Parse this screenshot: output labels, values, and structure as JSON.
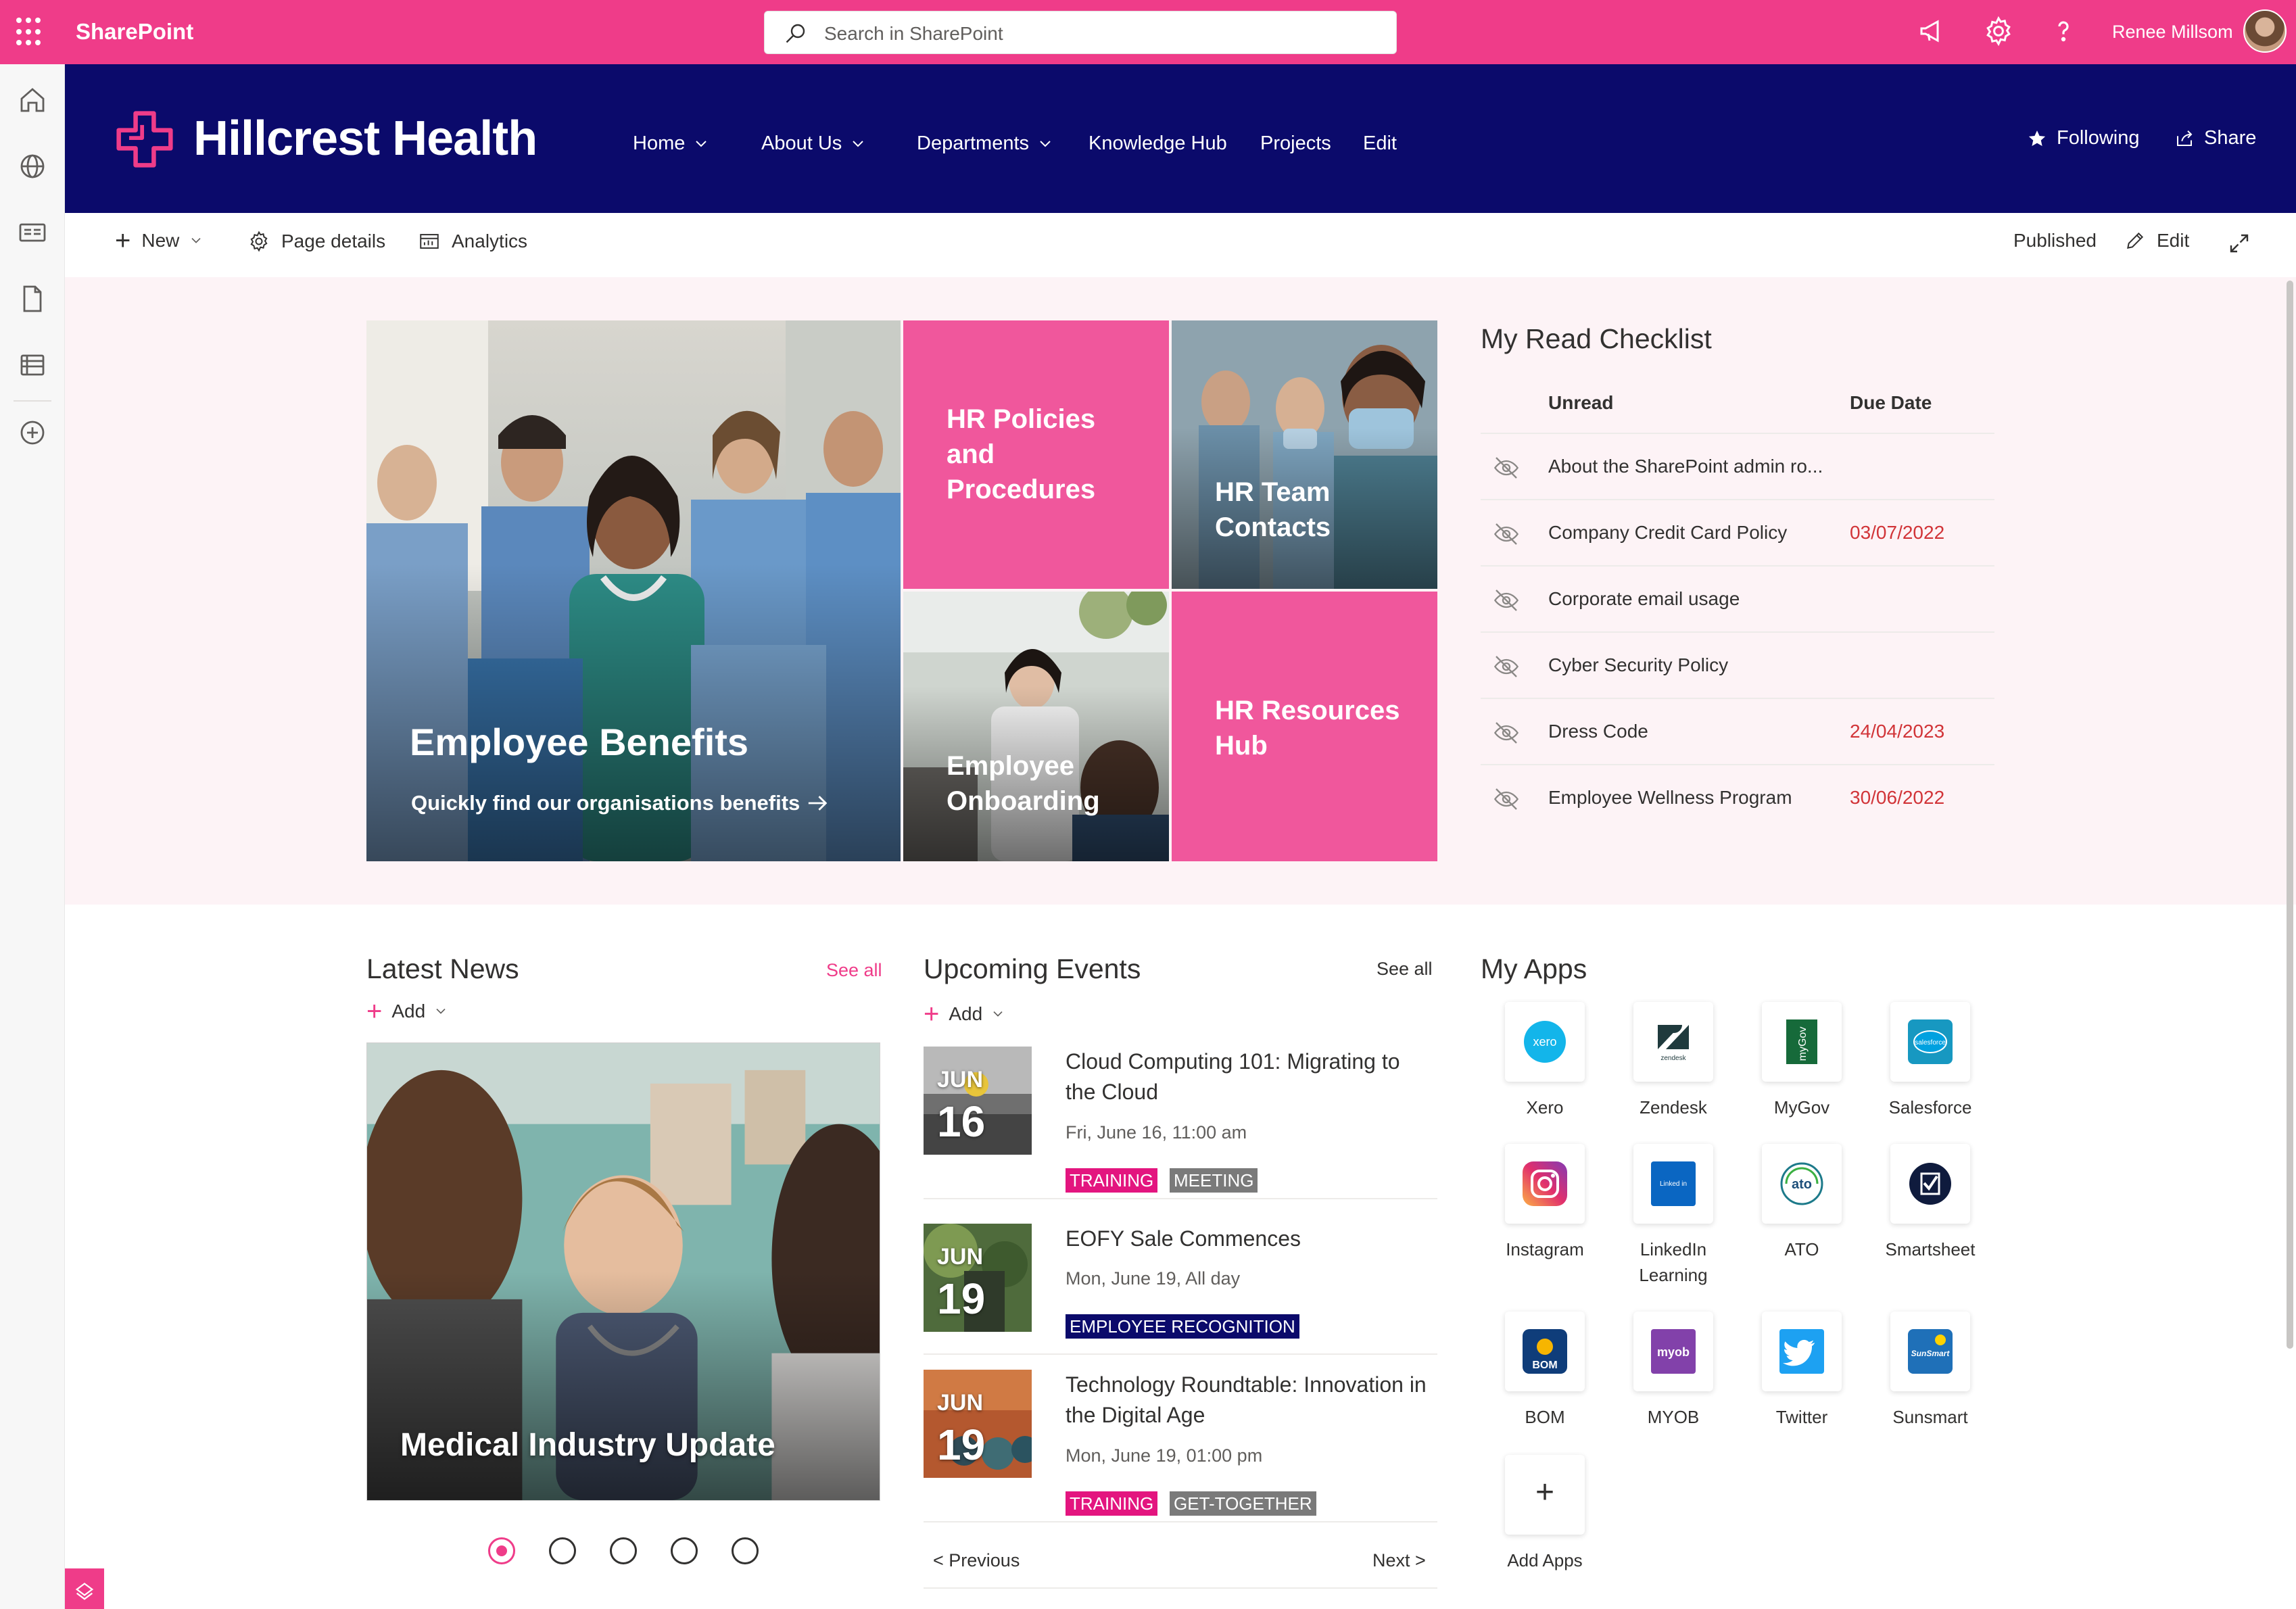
{
  "suite_bar": {
    "app_name": "SharePoint",
    "search_placeholder": "Search in SharePoint",
    "user_name": "Renee Millsom",
    "brand_color": "#ef3c89"
  },
  "left_rail": {
    "icons": [
      "home-icon",
      "globe-icon",
      "news-icon",
      "document-icon",
      "list-icon",
      "create-icon"
    ]
  },
  "site_header": {
    "title": "Hillcrest Health",
    "background_color": "#0b0a6b",
    "nav": [
      {
        "label": "Home",
        "dropdown": true
      },
      {
        "label": "About Us",
        "dropdown": true
      },
      {
        "label": "Departments",
        "dropdown": true
      },
      {
        "label": "Knowledge Hub",
        "dropdown": false
      },
      {
        "label": "Projects",
        "dropdown": false
      },
      {
        "label": "Edit",
        "dropdown": false
      }
    ],
    "following_label": "Following",
    "share_label": "Share"
  },
  "command_bar": {
    "new_label": "New",
    "page_details_label": "Page details",
    "analytics_label": "Analytics",
    "status": "Published",
    "edit_label": "Edit"
  },
  "hero": {
    "main": {
      "title": "Employee Benefits",
      "link_text": "Quickly find our organisations benefits"
    },
    "tiles": [
      {
        "title": "HR Policies and Procedures"
      },
      {
        "title": "HR Team Contacts"
      },
      {
        "title": "Employee Onboarding"
      },
      {
        "title": "HR Resources Hub"
      }
    ]
  },
  "read_checklist": {
    "title": "My Read Checklist",
    "columns": [
      "Unread",
      "Due Date"
    ],
    "rows": [
      {
        "title": "About the SharePoint admin ro...",
        "due": ""
      },
      {
        "title": "Company Credit Card Policy",
        "due": "03/07/2022"
      },
      {
        "title": "Corporate email usage",
        "due": ""
      },
      {
        "title": "Cyber Security Policy",
        "due": ""
      },
      {
        "title": "Dress Code",
        "due": "24/04/2023"
      },
      {
        "title": "Employee Wellness Program",
        "due": "30/06/2022"
      }
    ]
  },
  "latest_news": {
    "title": "Latest News",
    "see_all": "See all",
    "add_label": "Add",
    "card_title": "Medical Industry Update",
    "carousel_dots": 5,
    "active_dot": 0
  },
  "upcoming_events": {
    "title": "Upcoming Events",
    "see_all": "See all",
    "add_label": "Add",
    "events": [
      {
        "month": "JUN",
        "day": "16",
        "title": "Cloud Computing 101: Migrating to the Cloud",
        "when": "Fri, June 16, 11:00 am",
        "tags": [
          {
            "label": "TRAINING",
            "color": "#e3157f"
          },
          {
            "label": "MEETING",
            "color": "#7a7a7a"
          }
        ]
      },
      {
        "month": "JUN",
        "day": "19",
        "title": "EOFY Sale Commences",
        "when": "Mon, June 19, All day",
        "tags": [
          {
            "label": "EMPLOYEE RECOGNITION",
            "color": "#0b0a6b"
          }
        ]
      },
      {
        "month": "JUN",
        "day": "19",
        "title": "Technology Roundtable: Innovation in the Digital Age",
        "when": "Mon, June 19, 01:00 pm",
        "tags": [
          {
            "label": "TRAINING",
            "color": "#e3157f"
          },
          {
            "label": "GET-TOGETHER",
            "color": "#7a7a7a"
          }
        ]
      }
    ],
    "previous_label": "< Previous",
    "next_label": "Next >"
  },
  "my_apps": {
    "title": "My Apps",
    "apps": [
      {
        "name": "Xero",
        "icon": "xero-icon"
      },
      {
        "name": "Zendesk",
        "icon": "zendesk-icon"
      },
      {
        "name": "MyGov",
        "icon": "mygov-icon"
      },
      {
        "name": "Salesforce",
        "icon": "salesforce-icon"
      },
      {
        "name": "Instagram",
        "icon": "instagram-icon"
      },
      {
        "name": "LinkedIn Learning",
        "icon": "linkedin-learning-icon"
      },
      {
        "name": "ATO",
        "icon": "ato-icon"
      },
      {
        "name": "Smartsheet",
        "icon": "smartsheet-icon"
      },
      {
        "name": "BOM",
        "icon": "bom-icon"
      },
      {
        "name": "MYOB",
        "icon": "myob-icon"
      },
      {
        "name": "Twitter",
        "icon": "twitter-icon"
      },
      {
        "name": "Sunsmart",
        "icon": "sunsmart-icon"
      }
    ],
    "add_apps_label": "Add Apps",
    "icon_text": {
      "xero": "xero",
      "zendesk": "zendesk",
      "mygov": "myGov",
      "salesforce": "salesforce",
      "linkedin": "Linked in",
      "ato": "ato",
      "bom": "BOM",
      "myob": "myob",
      "sunsmart": "SunSmart"
    }
  }
}
